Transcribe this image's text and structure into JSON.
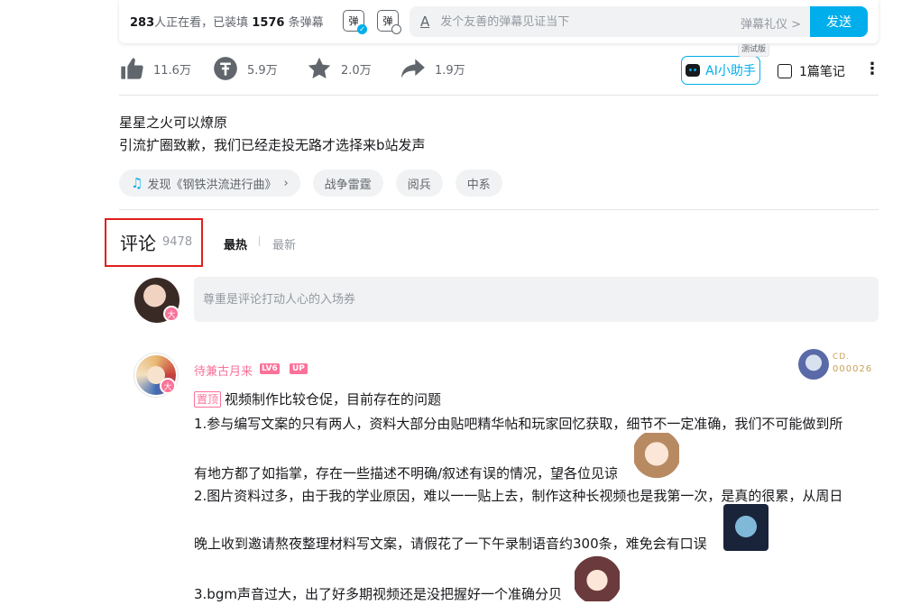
{
  "danmaku": {
    "viewers_count": "283",
    "viewers_suffix": "人正在看，已装填 ",
    "loaded_count": "1576",
    "loaded_suffix": " 条弹幕",
    "toggle_label": "弹",
    "settings_label": "弹",
    "input_icon": "A",
    "input_placeholder": "发个友善的弹幕见证当下",
    "etiquette_label": "弹幕礼仪 >",
    "send_label": "发送"
  },
  "toolbar": {
    "like_count": "11.6万",
    "coin_count": "5.9万",
    "fav_count": "2.0万",
    "share_count": "1.9万",
    "ai_label": "AI小助手",
    "beta_label": "测试版",
    "notes_label": "1篇笔记"
  },
  "description": {
    "line1": "星星之火可以燎原",
    "line2": "引流扩圈致歉，我们已经走投无路才选择来b站发声"
  },
  "tags": [
    {
      "label": "发现《钢铁洪流进行曲》"
    },
    {
      "label": "战争雷霆"
    },
    {
      "label": "阅兵"
    },
    {
      "label": "中系"
    }
  ],
  "comments": {
    "title": "评论",
    "count": "9478",
    "sort_hot": "最热",
    "sort_new": "最新",
    "input_placeholder": "尊重是评论打动人心的入场券",
    "my_badge": "大"
  },
  "pinned": {
    "username": "待兼古月来",
    "level": "LV6",
    "up_tag": "UP",
    "badge": "大",
    "fan_name": "CD.",
    "fan_number": "000026",
    "pin_label": "置顶",
    "line0": "视频制作比较仓促，目前存在的问题",
    "line1": "1.参与编写文案的只有两人，资料大部分由贴吧精华帖和玩家回忆获取，细节不一定准确，我们不可能做到所",
    "line2": "有地方都了如指掌，存在一些描述不明确/叙述有误的情况，望各位见谅",
    "line3": "2.图片资料过多，由于我的学业原因，难以一一贴上去，制作这种长视频也是我第一次，是真的很累，从周日",
    "line4": "晚上收到邀请熬夜整理材料写文案，请假花了一下午录制语音约300条，难免会有口误",
    "line5": "3.bgm声音过大，出了好多期视频还是没把握好一个准确分贝"
  }
}
